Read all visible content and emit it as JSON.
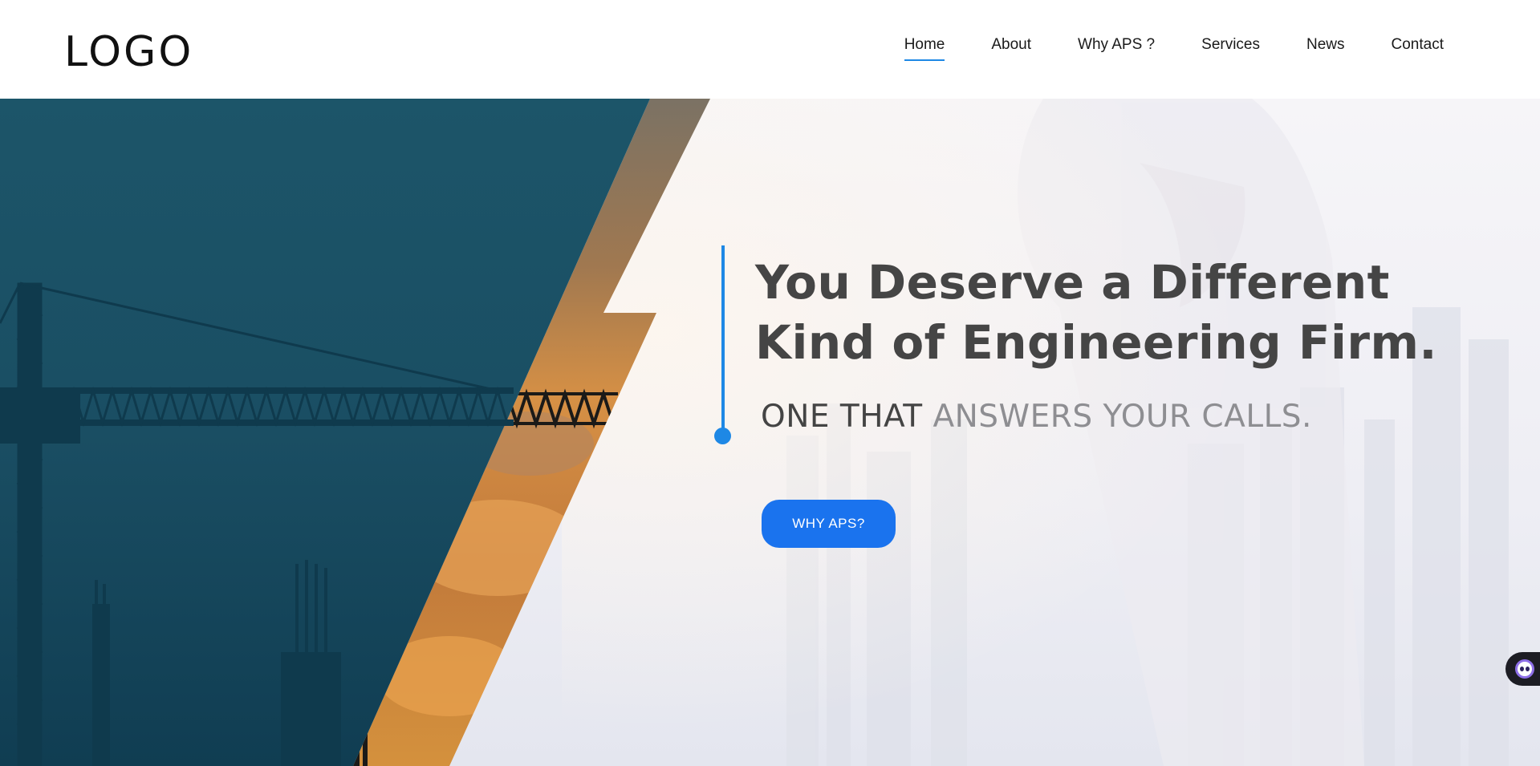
{
  "header": {
    "logo": "LOGO",
    "nav": [
      {
        "label": "Home",
        "active": true
      },
      {
        "label": "About"
      },
      {
        "label": "Why APS ?"
      },
      {
        "label": "Services"
      },
      {
        "label": "News"
      },
      {
        "label": "Contact"
      }
    ]
  },
  "hero": {
    "headline_line1": "You Deserve a Different",
    "headline_line2": "Kind of Engineering Firm.",
    "subline_part1": "ONE THAT ",
    "subline_part2": "ANSWERS YOUR CALLS.",
    "cta_label": "WHY APS?"
  },
  "chat_widget": {
    "icon": "chat-bot-icon"
  },
  "colors": {
    "accent": "#1e88e5",
    "button": "#1a73ee",
    "teal_panel": "#1b5266",
    "headline": "#454545",
    "subline_muted": "#8e8e92"
  }
}
